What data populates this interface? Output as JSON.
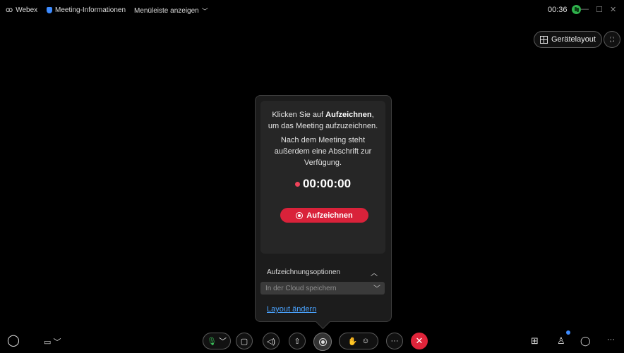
{
  "topbar": {
    "app_name": "Webex",
    "meeting_info": "Meeting-Informationen",
    "menu_bar": "Menüleiste anzeigen",
    "timer": "00:36",
    "device_layout": "Gerätelayout"
  },
  "recording_popup": {
    "line1_prefix": "Klicken Sie auf ",
    "line1_bold": "Aufzeichnen",
    "line1_suffix": ",",
    "line2": "um das Meeting aufzuzeichnen.",
    "info": "Nach dem Meeting steht außerdem eine Abschrift zur Verfügung.",
    "duration": "00:00:00",
    "record_button": "Aufzeichnen",
    "options_label": "Aufzeichnungsoptionen",
    "storage_select": "In der Cloud speichern",
    "change_layout": "Layout ändern"
  },
  "colors": {
    "accent_red": "#d9223a",
    "end_call": "#e0243a",
    "link_blue": "#4aa3ff",
    "status_green": "#2fb24c"
  },
  "icons": [
    "webex-logo-icon",
    "shield-icon",
    "chevron-down-icon",
    "status-icon",
    "minimize-icon",
    "maximize-icon",
    "close-icon",
    "grid-icon",
    "fullscreen-icon",
    "record-icon",
    "chevron-up-icon",
    "chevron-down-icon",
    "ai-assistant-icon",
    "captions-icon",
    "microphone-icon",
    "camera-icon",
    "speaker-icon",
    "share-icon",
    "raise-hand-icon",
    "reactions-icon",
    "more-icon",
    "end-call-icon",
    "apps-icon",
    "participants-icon",
    "chat-icon"
  ]
}
